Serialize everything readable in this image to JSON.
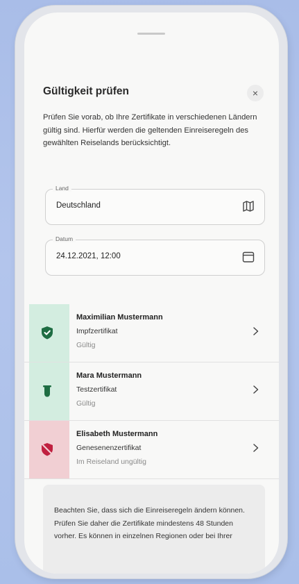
{
  "dialog": {
    "title": "Gültigkeit prüfen",
    "close_label": "×",
    "description": "Prüfen Sie vorab, ob Ihre Zertifikate in verschiedenen Ländern gültig sind. Hierfür werden die geltenden Einreiseregeln des gewählten Reiselands berücksichtigt."
  },
  "fields": {
    "country": {
      "label": "Land",
      "value": "Deutschland",
      "icon": "map-icon"
    },
    "date": {
      "label": "Datum",
      "value": "24.12.2021, 12:00",
      "icon": "calendar-icon"
    }
  },
  "certificates": [
    {
      "name": "Maximilian Mustermann",
      "type": "Impfzertifikat",
      "status": "Gültig",
      "icon": "shield-check-icon",
      "color": "#1e6d43"
    },
    {
      "name": "Mara Mustermann",
      "type": "Testzertifikat",
      "status": "Gültig",
      "icon": "test-tube-icon",
      "color": "#1e6d43"
    },
    {
      "name": "Elisabeth Mustermann",
      "type": "Genesenenzertifikat",
      "status": "Im Reiseland ungültig",
      "icon": "shield-off-icon",
      "color": "#c0203f"
    }
  ],
  "info": {
    "text": "Beachten Sie, dass sich die Einreiseregeln ändern können. Prüfen Sie daher die Zertifikate mindestens 48 Stunden vorher. Es können in einzelnen Regionen oder bei Ihrer"
  },
  "colors": {
    "valid_green": "#1e6d43",
    "invalid_red": "#c0203f",
    "valid_bg": "#d3ede0",
    "invalid_bg": "#f1cfd3"
  }
}
